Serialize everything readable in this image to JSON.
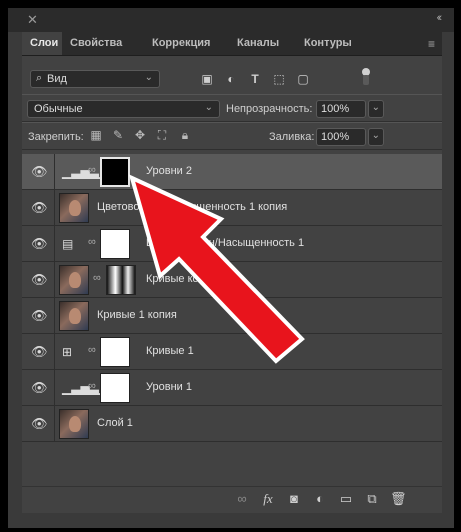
{
  "window": {
    "close_glyph": "✕",
    "collapse_glyph": "‹‹"
  },
  "tabs": [
    {
      "label": "Слои",
      "active": true
    },
    {
      "label": "Свойства",
      "active": false
    },
    {
      "label": "Коррекция",
      "active": false
    },
    {
      "label": "Каналы",
      "active": false
    },
    {
      "label": "Контуры",
      "active": false
    }
  ],
  "filter": {
    "label": "Вид",
    "icon": "search-icon"
  },
  "filter_icons": [
    "image-filter-icon",
    "adjustment-filter-icon",
    "type-filter-icon",
    "shape-filter-icon",
    "smart-object-filter-icon"
  ],
  "blend": {
    "mode": "Обычные",
    "opacity_label": "Непрозрачность:",
    "opacity_value": "100%"
  },
  "lock": {
    "label": "Закрепить:",
    "fill_label": "Заливка:",
    "fill_value": "100%"
  },
  "layers": [
    {
      "name": "Уровни 2",
      "kind": "adjustment-levels",
      "mask": "black",
      "selected": true
    },
    {
      "name": "Цветовой тон/Насыщенность 1 копия",
      "kind": "image"
    },
    {
      "name": "Цветовой тон/Насыщенность 1",
      "kind": "adjustment-hue",
      "mask": "white"
    },
    {
      "name": "Кривые копия 2",
      "kind": "image-with-mask"
    },
    {
      "name": "Кривые 1 копия",
      "kind": "image"
    },
    {
      "name": "Кривые 1",
      "kind": "adjustment-curves",
      "mask": "white"
    },
    {
      "name": "Уровни 1",
      "kind": "adjustment-levels",
      "mask": "white"
    },
    {
      "name": "Слой 1",
      "kind": "image"
    }
  ],
  "bottom_icons": [
    "link-icon",
    "fx-icon",
    "add-mask-icon",
    "adjustment-layer-icon",
    "group-folder-icon",
    "new-layer-icon",
    "trash-icon"
  ],
  "colors": {
    "annotation_arrow": "#e8141c",
    "panel_bg": "#424242",
    "selected_row": "#5a5a5a"
  }
}
